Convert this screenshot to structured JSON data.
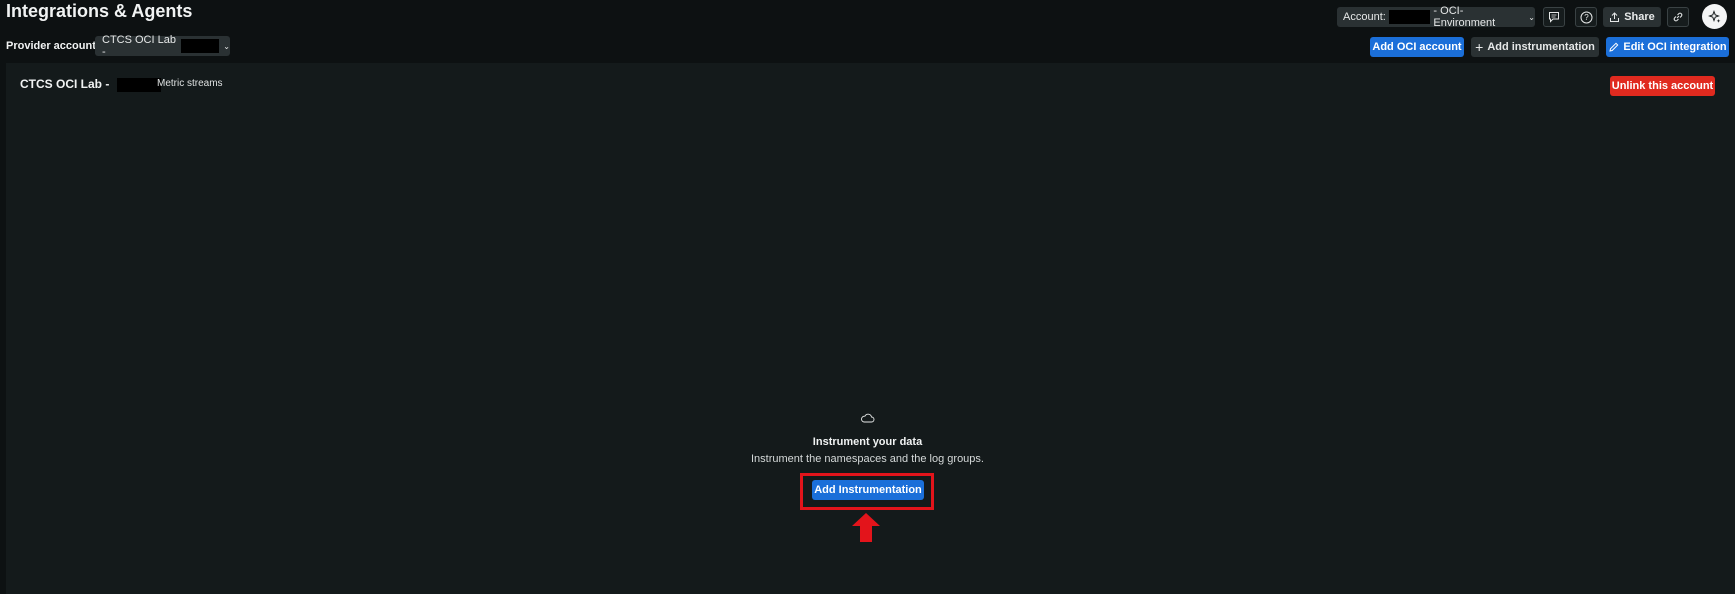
{
  "header": {
    "title": "Integrations & Agents",
    "account_prefix": "Account:",
    "account_suffix": "- OCI-Environment",
    "share_label": "Share"
  },
  "provider": {
    "label": "Provider account",
    "selected": "CTCS OCI Lab -"
  },
  "actions": {
    "add_account": "Add OCI account",
    "add_instrumentation": "Add instrumentation",
    "edit_integration": "Edit OCI integration"
  },
  "panel": {
    "account_name": "CTCS OCI Lab -",
    "metric_streams": "Metric streams",
    "unlink": "Unlink this account"
  },
  "empty_state": {
    "icon": "cloud-icon",
    "title": "Instrument your data",
    "subtitle": "Instrument the namespaces and the log groups.",
    "button": "Add Instrumentation"
  },
  "colors": {
    "primary": "#1b6fd9",
    "danger": "#e02a1f",
    "annotation": "#e3141b"
  }
}
